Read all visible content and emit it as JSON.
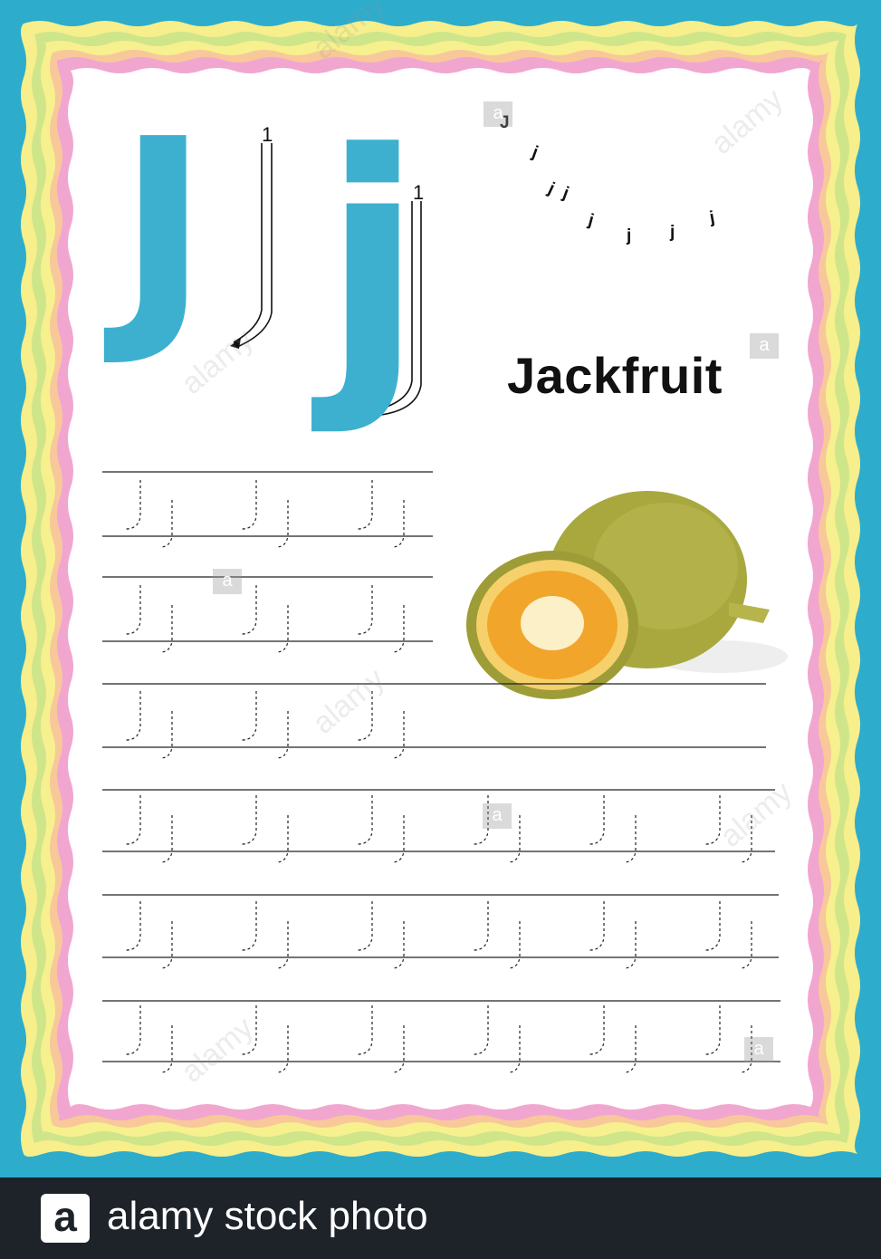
{
  "worksheet": {
    "upper_letter": "J",
    "lower_letter": "j",
    "stroke_number_upper": "1",
    "stroke_number_lower": "1",
    "word": "Jackfruit",
    "small_letter_upper": "J",
    "small_letter_lower": "j"
  },
  "watermark": {
    "text": "alamy",
    "box_letter": "a"
  },
  "footer": {
    "logo_letter": "a",
    "brand_text": "alamy stock photo"
  },
  "colors": {
    "background": "#2eaccb",
    "letter_fill": "#3db0cf",
    "border_pink": "#f1a6cf",
    "border_yellow": "#f6ef8c",
    "border_peach": "#f8c89a",
    "border_green": "#cfe58a",
    "footer": "#1d2329"
  }
}
